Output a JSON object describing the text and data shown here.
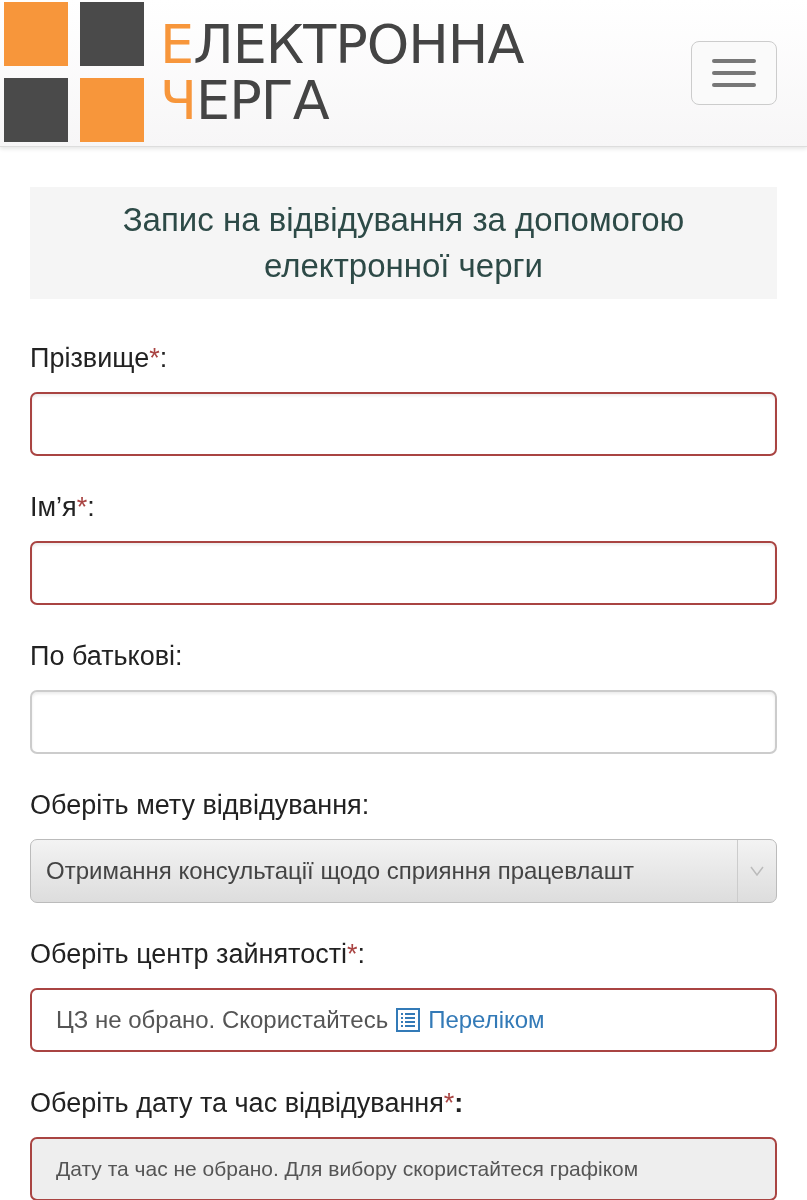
{
  "logo": {
    "lines": [
      "ЕЛЕКТРОННА",
      "ЧЕРГА"
    ]
  },
  "title": "Запис на відвідування за допомогою електронної черги",
  "fields": [
    {
      "kind": "text",
      "label": "Прізвище",
      "mark": "*",
      "colon": ":",
      "invalid": true
    },
    {
      "kind": "text",
      "label": "Ім’я",
      "mark": "*",
      "colon": ":",
      "invalid": true
    },
    {
      "kind": "text",
      "label": "По батькові",
      "colon": ":",
      "invalid": false
    },
    {
      "kind": "select",
      "label": "Оберіть мету відвідування",
      "colon": ":",
      "value": "Отримання консультації щодо сприяння працевлашт",
      "invalid": false
    },
    {
      "kind": "info",
      "label": "Оберіть центр зайнятості",
      "mark": "*",
      "colon": ":",
      "text": "ЦЗ не обрано. Скористайтесь",
      "link": "Переліком",
      "invalid": true
    },
    {
      "kind": "note",
      "label": "Оберіть дату та час відвідування",
      "mark": "*",
      "colon": "**:**",
      "text": "Дату та час не обрано. Для вибору скористайтеся графіком",
      "invalid": true
    }
  ]
}
